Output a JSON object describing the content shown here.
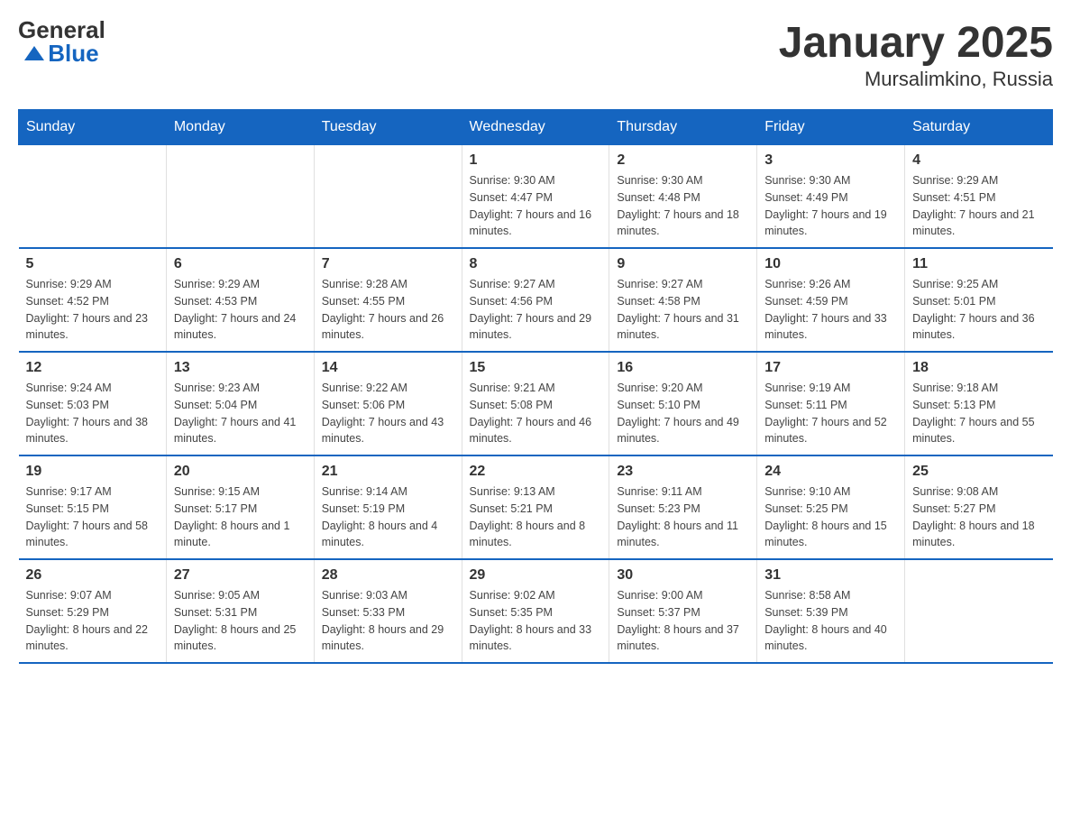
{
  "logo": {
    "general": "General",
    "blue": "Blue"
  },
  "title": {
    "month_year": "January 2025",
    "location": "Mursalimkino, Russia"
  },
  "days_of_week": [
    "Sunday",
    "Monday",
    "Tuesday",
    "Wednesday",
    "Thursday",
    "Friday",
    "Saturday"
  ],
  "weeks": [
    [
      {
        "day": "",
        "sunrise": "",
        "sunset": "",
        "daylight": ""
      },
      {
        "day": "",
        "sunrise": "",
        "sunset": "",
        "daylight": ""
      },
      {
        "day": "",
        "sunrise": "",
        "sunset": "",
        "daylight": ""
      },
      {
        "day": "1",
        "sunrise": "Sunrise: 9:30 AM",
        "sunset": "Sunset: 4:47 PM",
        "daylight": "Daylight: 7 hours and 16 minutes."
      },
      {
        "day": "2",
        "sunrise": "Sunrise: 9:30 AM",
        "sunset": "Sunset: 4:48 PM",
        "daylight": "Daylight: 7 hours and 18 minutes."
      },
      {
        "day": "3",
        "sunrise": "Sunrise: 9:30 AM",
        "sunset": "Sunset: 4:49 PM",
        "daylight": "Daylight: 7 hours and 19 minutes."
      },
      {
        "day": "4",
        "sunrise": "Sunrise: 9:29 AM",
        "sunset": "Sunset: 4:51 PM",
        "daylight": "Daylight: 7 hours and 21 minutes."
      }
    ],
    [
      {
        "day": "5",
        "sunrise": "Sunrise: 9:29 AM",
        "sunset": "Sunset: 4:52 PM",
        "daylight": "Daylight: 7 hours and 23 minutes."
      },
      {
        "day": "6",
        "sunrise": "Sunrise: 9:29 AM",
        "sunset": "Sunset: 4:53 PM",
        "daylight": "Daylight: 7 hours and 24 minutes."
      },
      {
        "day": "7",
        "sunrise": "Sunrise: 9:28 AM",
        "sunset": "Sunset: 4:55 PM",
        "daylight": "Daylight: 7 hours and 26 minutes."
      },
      {
        "day": "8",
        "sunrise": "Sunrise: 9:27 AM",
        "sunset": "Sunset: 4:56 PM",
        "daylight": "Daylight: 7 hours and 29 minutes."
      },
      {
        "day": "9",
        "sunrise": "Sunrise: 9:27 AM",
        "sunset": "Sunset: 4:58 PM",
        "daylight": "Daylight: 7 hours and 31 minutes."
      },
      {
        "day": "10",
        "sunrise": "Sunrise: 9:26 AM",
        "sunset": "Sunset: 4:59 PM",
        "daylight": "Daylight: 7 hours and 33 minutes."
      },
      {
        "day": "11",
        "sunrise": "Sunrise: 9:25 AM",
        "sunset": "Sunset: 5:01 PM",
        "daylight": "Daylight: 7 hours and 36 minutes."
      }
    ],
    [
      {
        "day": "12",
        "sunrise": "Sunrise: 9:24 AM",
        "sunset": "Sunset: 5:03 PM",
        "daylight": "Daylight: 7 hours and 38 minutes."
      },
      {
        "day": "13",
        "sunrise": "Sunrise: 9:23 AM",
        "sunset": "Sunset: 5:04 PM",
        "daylight": "Daylight: 7 hours and 41 minutes."
      },
      {
        "day": "14",
        "sunrise": "Sunrise: 9:22 AM",
        "sunset": "Sunset: 5:06 PM",
        "daylight": "Daylight: 7 hours and 43 minutes."
      },
      {
        "day": "15",
        "sunrise": "Sunrise: 9:21 AM",
        "sunset": "Sunset: 5:08 PM",
        "daylight": "Daylight: 7 hours and 46 minutes."
      },
      {
        "day": "16",
        "sunrise": "Sunrise: 9:20 AM",
        "sunset": "Sunset: 5:10 PM",
        "daylight": "Daylight: 7 hours and 49 minutes."
      },
      {
        "day": "17",
        "sunrise": "Sunrise: 9:19 AM",
        "sunset": "Sunset: 5:11 PM",
        "daylight": "Daylight: 7 hours and 52 minutes."
      },
      {
        "day": "18",
        "sunrise": "Sunrise: 9:18 AM",
        "sunset": "Sunset: 5:13 PM",
        "daylight": "Daylight: 7 hours and 55 minutes."
      }
    ],
    [
      {
        "day": "19",
        "sunrise": "Sunrise: 9:17 AM",
        "sunset": "Sunset: 5:15 PM",
        "daylight": "Daylight: 7 hours and 58 minutes."
      },
      {
        "day": "20",
        "sunrise": "Sunrise: 9:15 AM",
        "sunset": "Sunset: 5:17 PM",
        "daylight": "Daylight: 8 hours and 1 minute."
      },
      {
        "day": "21",
        "sunrise": "Sunrise: 9:14 AM",
        "sunset": "Sunset: 5:19 PM",
        "daylight": "Daylight: 8 hours and 4 minutes."
      },
      {
        "day": "22",
        "sunrise": "Sunrise: 9:13 AM",
        "sunset": "Sunset: 5:21 PM",
        "daylight": "Daylight: 8 hours and 8 minutes."
      },
      {
        "day": "23",
        "sunrise": "Sunrise: 9:11 AM",
        "sunset": "Sunset: 5:23 PM",
        "daylight": "Daylight: 8 hours and 11 minutes."
      },
      {
        "day": "24",
        "sunrise": "Sunrise: 9:10 AM",
        "sunset": "Sunset: 5:25 PM",
        "daylight": "Daylight: 8 hours and 15 minutes."
      },
      {
        "day": "25",
        "sunrise": "Sunrise: 9:08 AM",
        "sunset": "Sunset: 5:27 PM",
        "daylight": "Daylight: 8 hours and 18 minutes."
      }
    ],
    [
      {
        "day": "26",
        "sunrise": "Sunrise: 9:07 AM",
        "sunset": "Sunset: 5:29 PM",
        "daylight": "Daylight: 8 hours and 22 minutes."
      },
      {
        "day": "27",
        "sunrise": "Sunrise: 9:05 AM",
        "sunset": "Sunset: 5:31 PM",
        "daylight": "Daylight: 8 hours and 25 minutes."
      },
      {
        "day": "28",
        "sunrise": "Sunrise: 9:03 AM",
        "sunset": "Sunset: 5:33 PM",
        "daylight": "Daylight: 8 hours and 29 minutes."
      },
      {
        "day": "29",
        "sunrise": "Sunrise: 9:02 AM",
        "sunset": "Sunset: 5:35 PM",
        "daylight": "Daylight: 8 hours and 33 minutes."
      },
      {
        "day": "30",
        "sunrise": "Sunrise: 9:00 AM",
        "sunset": "Sunset: 5:37 PM",
        "daylight": "Daylight: 8 hours and 37 minutes."
      },
      {
        "day": "31",
        "sunrise": "Sunrise: 8:58 AM",
        "sunset": "Sunset: 5:39 PM",
        "daylight": "Daylight: 8 hours and 40 minutes."
      },
      {
        "day": "",
        "sunrise": "",
        "sunset": "",
        "daylight": ""
      }
    ]
  ]
}
